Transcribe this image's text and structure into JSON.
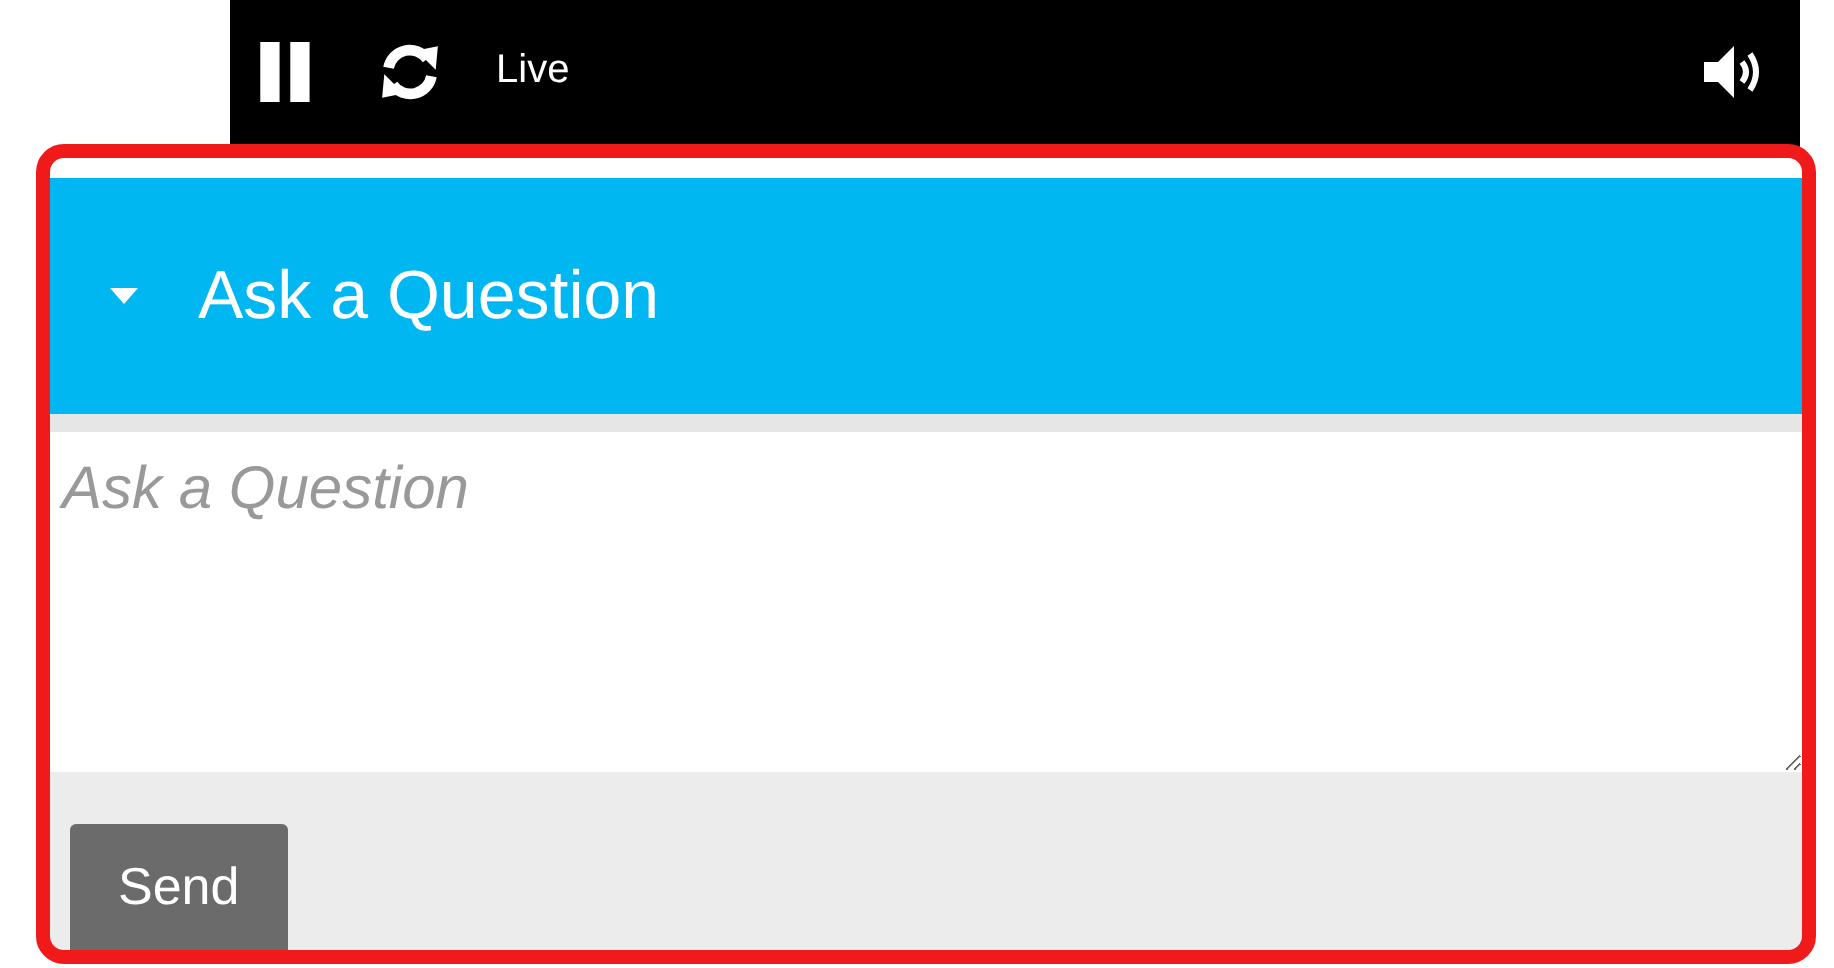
{
  "player": {
    "status": "Live"
  },
  "panel": {
    "title": "Ask a Question",
    "expanded": true,
    "question": {
      "placeholder": "Ask a Question"
    },
    "send_button": "Send"
  }
}
